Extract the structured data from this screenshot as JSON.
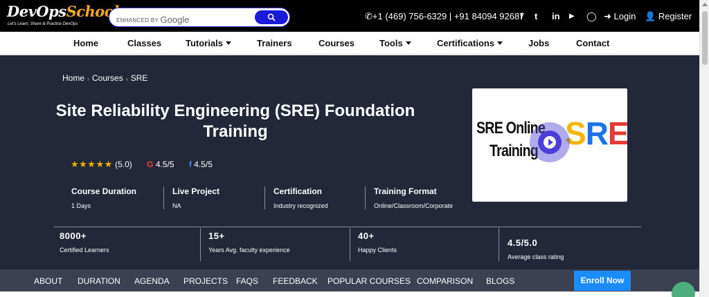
{
  "header": {
    "logo_main": "DevOps",
    "logo_second": "School",
    "logo_tagline": "Let's Learn, Share & Practice DevOps",
    "search_label": "ENHANCED BY",
    "search_brand": "Google",
    "phone_line": "+1 (469) 756-6329 | +91 84094 92687",
    "social_facebook": "f",
    "social_twitter": "t",
    "social_linkedin": "in",
    "social_youtube": "▶",
    "social_whatsapp": "◯",
    "login": "Login",
    "register": "Register"
  },
  "nav": {
    "home": "Home",
    "classes": "Classes",
    "tutorials": "Tutorials",
    "trainers": "Trainers",
    "courses": "Courses",
    "tools": "Tools",
    "certifications": "Certifications",
    "jobs": "Jobs",
    "contact": "Contact"
  },
  "breadcrumb": {
    "home": "Home",
    "courses": "Courses",
    "current": "SRE",
    "separator": "›"
  },
  "course": {
    "title": "Site Reliability Engineering (SRE) Foundation Training",
    "stars": "★★★★★",
    "rating": "(5.0)",
    "google_label": "G",
    "google_rating": "4.5/5",
    "facebook_label": "f",
    "facebook_rating": "4.5/5"
  },
  "info": [
    {
      "title": "Course Duration",
      "value": "1 Days"
    },
    {
      "title": "Live Project",
      "value": "NA"
    },
    {
      "title": "Certification",
      "value": "Industry recognized"
    },
    {
      "title": "Training Format",
      "value": "Online/Classroom/Corporate"
    }
  ],
  "stats": [
    {
      "number": "8000+",
      "label": "Certified Learners"
    },
    {
      "number": "15+",
      "label": "Years Avg. faculty experience"
    },
    {
      "number": "40+",
      "label": "Happy Clients"
    },
    {
      "number": "4.5/5.0",
      "label": "Average class rating"
    }
  ],
  "video": {
    "line1": "SRE Online",
    "line2": "Training",
    "logo_s": "S",
    "logo_r": "R",
    "logo_e": "E"
  },
  "tabs": {
    "about": "ABOUT",
    "duration": "DURATION",
    "agenda": "AGENDA",
    "projects": "PROJECTS",
    "faqs": "FAQS",
    "feedback": "FEEDBACK",
    "popular": "POPULAR COURSES",
    "comparison": "COMPARISON",
    "blogs": "BLOGS",
    "enroll": "Enroll Now"
  },
  "colors": {
    "hero_bg": "#232838",
    "accent_blue": "#1a8cff",
    "star": "#f5b400"
  }
}
